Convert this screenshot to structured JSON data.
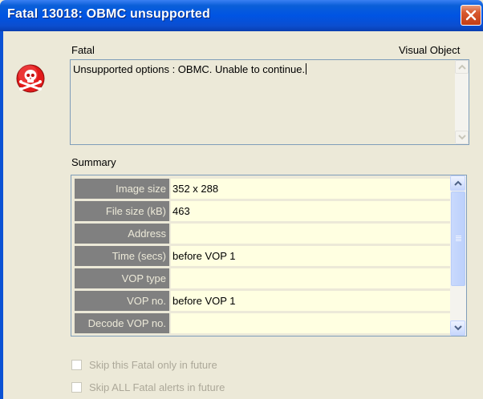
{
  "window": {
    "title": "Fatal 13018: OBMC unsupported",
    "close_icon": "close-x-icon"
  },
  "alert": {
    "icon": "skull-crossbones-icon",
    "icon_color": "#e21b1b",
    "severity_label": "Fatal",
    "source_label": "Visual Object",
    "message": "Unsupported options : OBMC. Unable to continue."
  },
  "summary": {
    "label": "Summary",
    "rows": [
      {
        "key": "Image size",
        "value": "352 x 288"
      },
      {
        "key": "File size (kB)",
        "value": "463"
      },
      {
        "key": "Address",
        "value": ""
      },
      {
        "key": "Time (secs)",
        "value": "before VOP 1"
      },
      {
        "key": "VOP type",
        "value": ""
      },
      {
        "key": "VOP no.",
        "value": "before VOP 1"
      },
      {
        "key": "Decode VOP no.",
        "value": ""
      }
    ]
  },
  "options": {
    "skip_this": {
      "label": "Skip this Fatal only in future",
      "checked": false,
      "enabled": false
    },
    "skip_all": {
      "label": "Skip ALL Fatal alerts in future",
      "checked": false,
      "enabled": false
    }
  },
  "colors": {
    "titlebar": "#0054e3",
    "dialog_bg": "#ece9d8",
    "key_cell_bg": "#808080",
    "value_cell_bg": "#ffffe1",
    "close_button": "#c43d14"
  }
}
